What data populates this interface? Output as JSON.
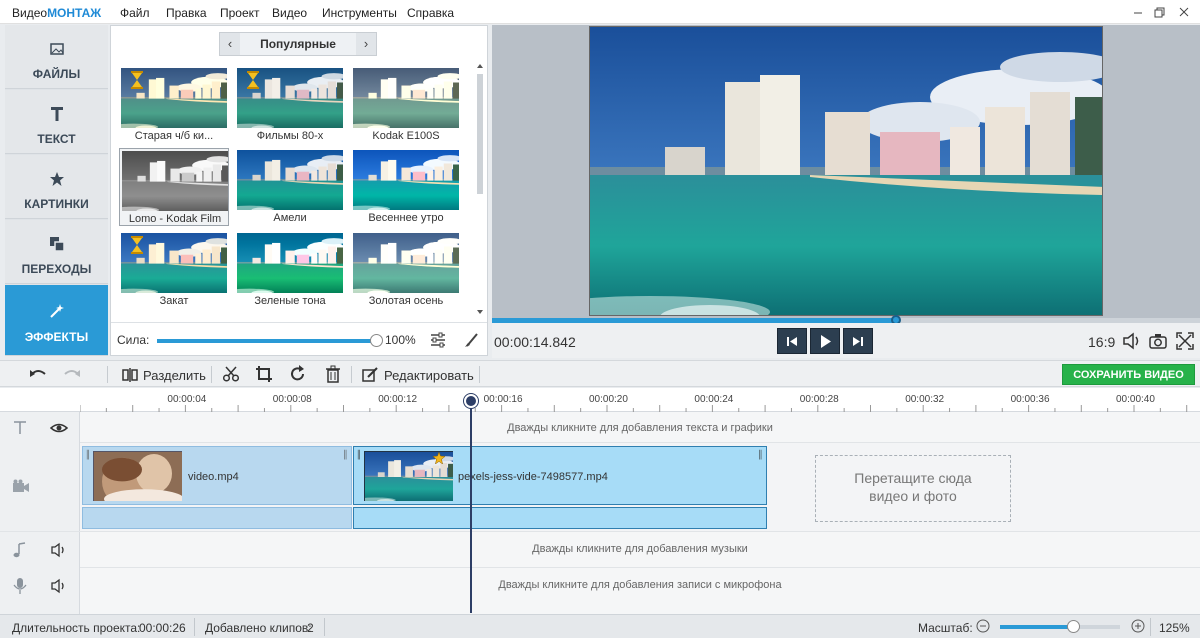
{
  "app": {
    "name_part1": "Видео",
    "name_part2": "МОНТАЖ"
  },
  "menu": [
    "Файл",
    "Правка",
    "Проект",
    "Видео",
    "Инструменты",
    "Справка"
  ],
  "left_tabs": [
    {
      "label": "ФАЙЛЫ",
      "icon": "image-icon"
    },
    {
      "label": "ТЕКСТ",
      "icon": "text-t-icon"
    },
    {
      "label": "КАРТИНКИ",
      "icon": "star-icon"
    },
    {
      "label": "ПЕРЕХОДЫ",
      "icon": "transition-icon"
    },
    {
      "label": "ЭФФЕКТЫ",
      "icon": "magic-wand-icon",
      "active": true
    }
  ],
  "effects": {
    "category": "Популярные",
    "items": [
      {
        "label": "Старая ч/б ки...",
        "style": "sepia"
      },
      {
        "label": "Фильмы 80-х",
        "style": "eighties"
      },
      {
        "label": "Kodak E100S",
        "style": "kodak"
      },
      {
        "label": "Lomo - Kodak Film",
        "style": "lomo",
        "selected": true
      },
      {
        "label": "Амели",
        "style": "amelie"
      },
      {
        "label": "Весеннее утро",
        "style": "spring"
      },
      {
        "label": "Закат",
        "style": "sunset"
      },
      {
        "label": "Зеленые тона",
        "style": "green"
      },
      {
        "label": "Золотая осень",
        "style": "autumn"
      }
    ],
    "strength_label": "Сила:",
    "strength_value": "100%",
    "strength_fraction": 1.0
  },
  "player": {
    "timecode": "00:00:14.842",
    "aspect": "16:9",
    "progress_fraction": 0.57
  },
  "toolbar": {
    "split_label": "Разделить",
    "edit_label": "Редактировать",
    "save_label": "СОХРАНИТЬ ВИДЕО"
  },
  "timeline": {
    "ticks": [
      "00:00:04",
      "00:00:08",
      "00:00:12",
      "00:00:16",
      "00:00:20",
      "00:00:24",
      "00:00:28",
      "00:00:32",
      "00:00:36",
      "00:00:40"
    ],
    "text_hint": "Дважды кликните для добавления текста и графики",
    "clips": [
      {
        "name": "video.mp4"
      },
      {
        "name": "pexels-jess-vide-7498577.mp4"
      }
    ],
    "dropzone_line1": "Перетащите сюда",
    "dropzone_line2": "видео и фото",
    "music_hint": "Дважды кликните для добавления музыки",
    "mic_hint": "Дважды кликните для добавления записи с микрофона"
  },
  "status": {
    "duration_label": "Длительность проекта:",
    "duration_value": "00:00:26",
    "clips_label": "Добавлено клипов:",
    "clips_value": "2",
    "zoom_label": "Масштаб:",
    "zoom_value": "125%",
    "zoom_fraction": 0.62
  },
  "colors": {
    "accent": "#2a9ad6",
    "save": "#27b24a"
  }
}
